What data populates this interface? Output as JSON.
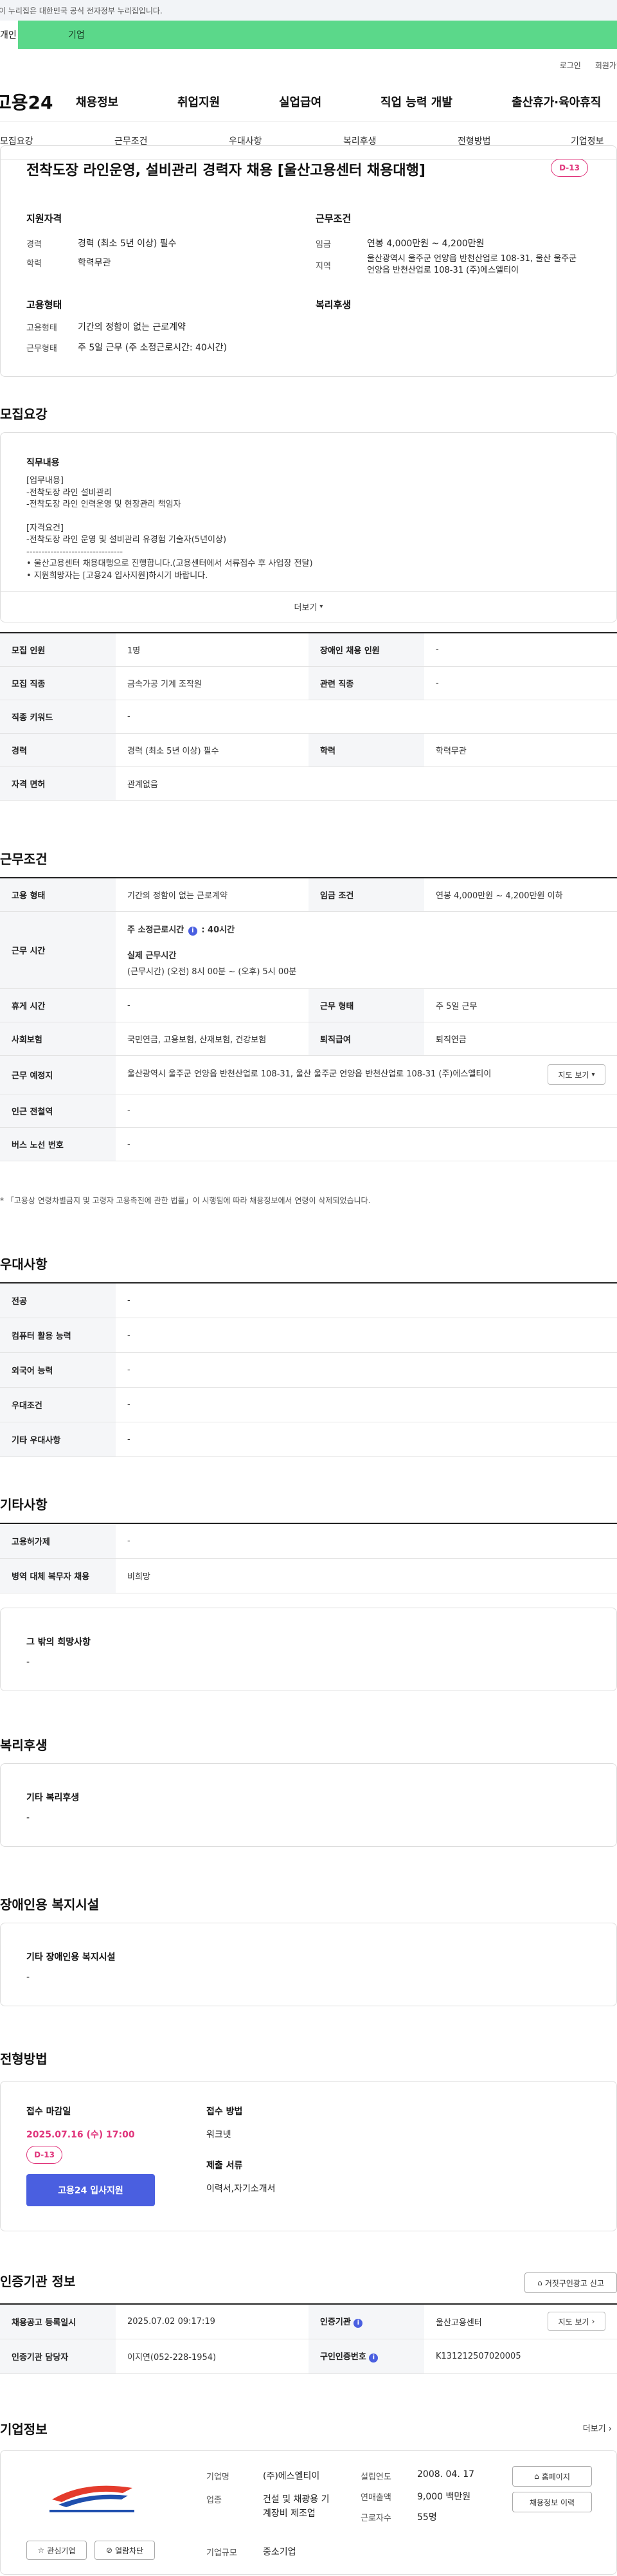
{
  "gov_banner": "이 누리집은 대한민국 공식 전자정부 누리집입니다.",
  "tabs": {
    "personal": "개인",
    "company": "기업"
  },
  "util": {
    "login": "로그인",
    "signup": "회원가입"
  },
  "gnb": {
    "logo": "고용24",
    "menu": [
      "채용정보",
      "취업지원",
      "실업급여",
      "직업 능력 개발",
      "출산휴가·육아휴직"
    ]
  },
  "anchors": [
    "모집요강",
    "근무조건",
    "우대사항",
    "복리후생",
    "전형방법",
    "기업정보"
  ],
  "summary": {
    "title": "전착도장 라인운영, 설비관리 경력자 채용 [울산고용센터 채용대행]",
    "dday": "D-13",
    "qual_heading": "지원자격",
    "career_label": "경력",
    "career_value": "경력 (최소 5년 이상) 필수",
    "edu_label": "학력",
    "edu_value": "학력무관",
    "work_heading": "근무조건",
    "wage_label": "임금",
    "wage_value": "연봉 4,000만원 ~ 4,200만원",
    "region_label": "지역",
    "region_value": "울산광역시 울주군 언양읍 반천산업로 108-31, 울산 울주군 언양읍 반천산업로 108-31 (주)에스엘티이",
    "emp_heading": "고용형태",
    "emp_label": "고용형태",
    "emp_value": "기간의 정함이 없는 근로계약",
    "worktype_label": "근무형태",
    "worktype_value": "주 5일 근무 (주 소정근로시간: 40시간)",
    "welfare_heading": "복리후생"
  },
  "recruit": {
    "section_title": "모집요강",
    "duty_heading": "직무내용",
    "duty_lines": [
      "[업무내용]",
      "-전착도장 라인 설비관리",
      "-전착도장 라인 인력운영 및 현장관리 책임자",
      "",
      "[자격요건]",
      "-전착도장 라인 운영 및 설비관리 유경험 기술자(5년이상)",
      "--------------------------------",
      "• 울산고용센터 채용대행으로 진행합니다.(고용센터에서 서류접수 후 사업장 전달)",
      "• 지원희망자는 [고용24 입사지원]하시기 바랍니다."
    ],
    "more": "더보기",
    "rows": {
      "count_h": "모집 인원",
      "count_v": "1명",
      "disabled_h": "장애인 채용 인원",
      "disabled_v": "-",
      "job_h": "모집 직종",
      "job_v": "금속가공 기계 조작원",
      "related_h": "관련 직종",
      "related_v": "-",
      "keyword_h": "직종 키워드",
      "keyword_v": "-",
      "career_h": "경력",
      "career_v": "경력 (최소 5년 이상) 필수",
      "edu_h": "학력",
      "edu_v": "학력무관",
      "license_h": "자격 면허",
      "license_v": "관계없음"
    }
  },
  "work": {
    "section_title": "근무조건",
    "emp_h": "고용 형태",
    "emp_v": "기간의 정함이 없는 근로계약",
    "wage_h": "임금 조건",
    "wage_v": "연봉 4,000만원 ~ 4,200만원 이하",
    "time_h": "근무 시간",
    "time_weekly": "주 소정근로시간",
    "time_weekly_v": ": 40시간",
    "time_actual": "실제 근무시간",
    "time_actual_v": "(근무시간) (오전) 8시 00분 ~ (오후) 5시 00분",
    "rest_h": "휴게 시간",
    "rest_v": "-",
    "form_h": "근무 형태",
    "form_v": "주 5일 근무",
    "ins_h": "사회보험",
    "ins_v": "국민연금, 고용보험, 산재보험, 건강보험",
    "ret_h": "퇴직급여",
    "ret_v": "퇴직연금",
    "place_h": "근무 예정지",
    "place_v": "울산광역시 울주군 언양읍 반천산업로 108-31, 울산 울주군 언양읍 반천산업로 108-31 (주)에스엘티이",
    "map_btn": "지도 보기",
    "subway_h": "인근 전철역",
    "subway_v": "-",
    "bus_h": "버스 노선 번호",
    "bus_v": "-",
    "note": "* 「고용상 연령차별금지 및 고령자 고용촉진에 관한 법률」이 시행됨에 따라 채용정보에서 연령이 삭제되었습니다."
  },
  "pref": {
    "section_title": "우대사항",
    "major_h": "전공",
    "major_v": "-",
    "pc_h": "컴퓨터 활용 능력",
    "pc_v": "-",
    "lang_h": "외국어 능력",
    "lang_v": "-",
    "cond_h": "우대조건",
    "cond_v": "-",
    "etc_h": "기타 우대사항",
    "etc_v": "-"
  },
  "other": {
    "section_title": "기타사항",
    "subsidy_h": "고용허가제",
    "subsidy_v": "-",
    "military_h": "병역 대체 복무자 채용",
    "military_v": "비희망",
    "other_heading": "그 밖의 희망사항",
    "other_value": "-"
  },
  "welfare": {
    "section_title": "복리후생",
    "heading": "기타 복리후생",
    "value": "-"
  },
  "disabled": {
    "section_title": "장애인용 복지시설",
    "heading": "기타 장애인용 복지시설",
    "value": "-"
  },
  "selection": {
    "section_title": "전형방법",
    "deadline_h": "접수 마감일",
    "deadline_v": "2025.07.16 (수) 17:00",
    "dday": "D-13",
    "apply_btn": "고용24 입사지원",
    "method_h": "접수 방법",
    "method_v": "워크넷",
    "docs_h": "제출 서류",
    "docs_v": "이력서,자기소개서"
  },
  "cert": {
    "section_title": "인증기관 정보",
    "report_btn": "거짓구인광고 신고",
    "reg_h": "채용공고 등록일시",
    "reg_v": "2025.07.02 09:17:19",
    "org_h": "인증기관",
    "org_v": "울산고용센터",
    "map_btn": "지도 보기",
    "manager_h": "인증기관 담당자",
    "manager_v": "이지연(052-228-1954)",
    "num_h": "구인인증번호",
    "num_v": "K131212507020005"
  },
  "company": {
    "section_title": "기업정보",
    "more": "더보기",
    "name_h": "기업명",
    "name_v": "(주)에스엘티이",
    "biz_h": "업종",
    "biz_v": "건설 및 채광용 기계장비 제조업",
    "size_h": "기업규모",
    "size_v": "중소기업",
    "year_h": "설립연도",
    "year_v": "2008. 04. 17",
    "sales_h": "연매출액",
    "sales_v": "9,000 백만원",
    "emp_h": "근로자수",
    "emp_v": "55명",
    "interest_btn": "관심기업",
    "block_btn": "열람차단",
    "home_btn": "홈페이지",
    "jobs_btn": "채용정보 이력"
  },
  "colors": {
    "accent": "#4a5fe0",
    "dday": "#e0337a",
    "tab_green": "#5bd88a"
  }
}
